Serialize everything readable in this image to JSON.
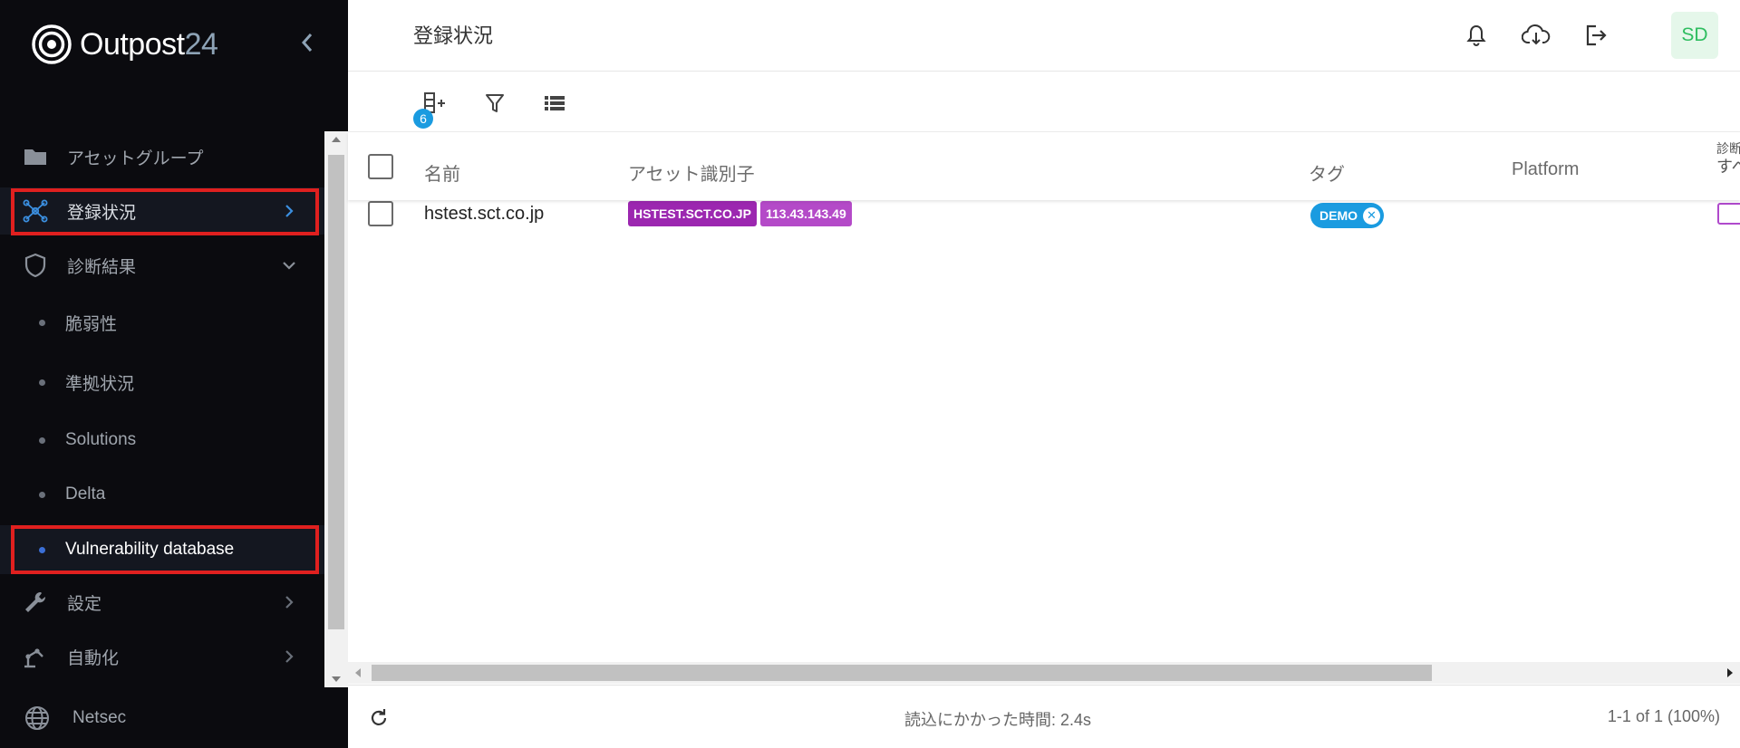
{
  "app": {
    "logo_main": "Outpost",
    "logo_accent": "24"
  },
  "sidebar": {
    "items": [
      {
        "label": "アセットグループ",
        "icon": "folder-icon"
      },
      {
        "label": "登録状況",
        "icon": "network-icon",
        "active": true
      },
      {
        "label": "診断結果",
        "icon": "shield-icon",
        "expanded": true
      },
      {
        "label": "設定",
        "icon": "wrench-icon"
      },
      {
        "label": "自動化",
        "icon": "robot-arm-icon"
      },
      {
        "label": "Netsec",
        "icon": "globe-icon"
      }
    ],
    "sub_items": [
      {
        "label": "脆弱性"
      },
      {
        "label": "準拠状況"
      },
      {
        "label": "Solutions"
      },
      {
        "label": "Delta"
      },
      {
        "label": "Vulnerability database",
        "active": true
      }
    ]
  },
  "header": {
    "title": "登録状況",
    "avatar_initials": "SD",
    "icons": [
      "bell-icon",
      "cloud-download-icon",
      "logout-icon"
    ]
  },
  "toolbar": {
    "add_asset_count": "6",
    "icons": [
      "add-asset-icon",
      "filter-icon",
      "list-view-icon"
    ]
  },
  "table": {
    "columns": {
      "name": "名前",
      "identifier": "アセット識別子",
      "tags": "タグ",
      "platform": "Platform",
      "cut_line1": "診断",
      "cut_line2": "すべ"
    },
    "rows": [
      {
        "name": "hstest.sct.co.jp",
        "identifiers": [
          "HSTEST.SCT.CO.JP",
          "113.43.143.49"
        ],
        "tag": "DEMO"
      }
    ]
  },
  "footer": {
    "load_time": "読込にかかった時間: 2.4s",
    "pagination": "1-1 of 1 (100%)"
  },
  "colors": {
    "sidebar_bg": "#0b0b0f",
    "highlight": "#e0201f",
    "chip_hostname": "#9c27b0",
    "chip_ip": "#b44ac8",
    "tag": "#1a9be0",
    "avatar_bg": "#e5f7ea",
    "avatar_text": "#2ebd5f"
  }
}
